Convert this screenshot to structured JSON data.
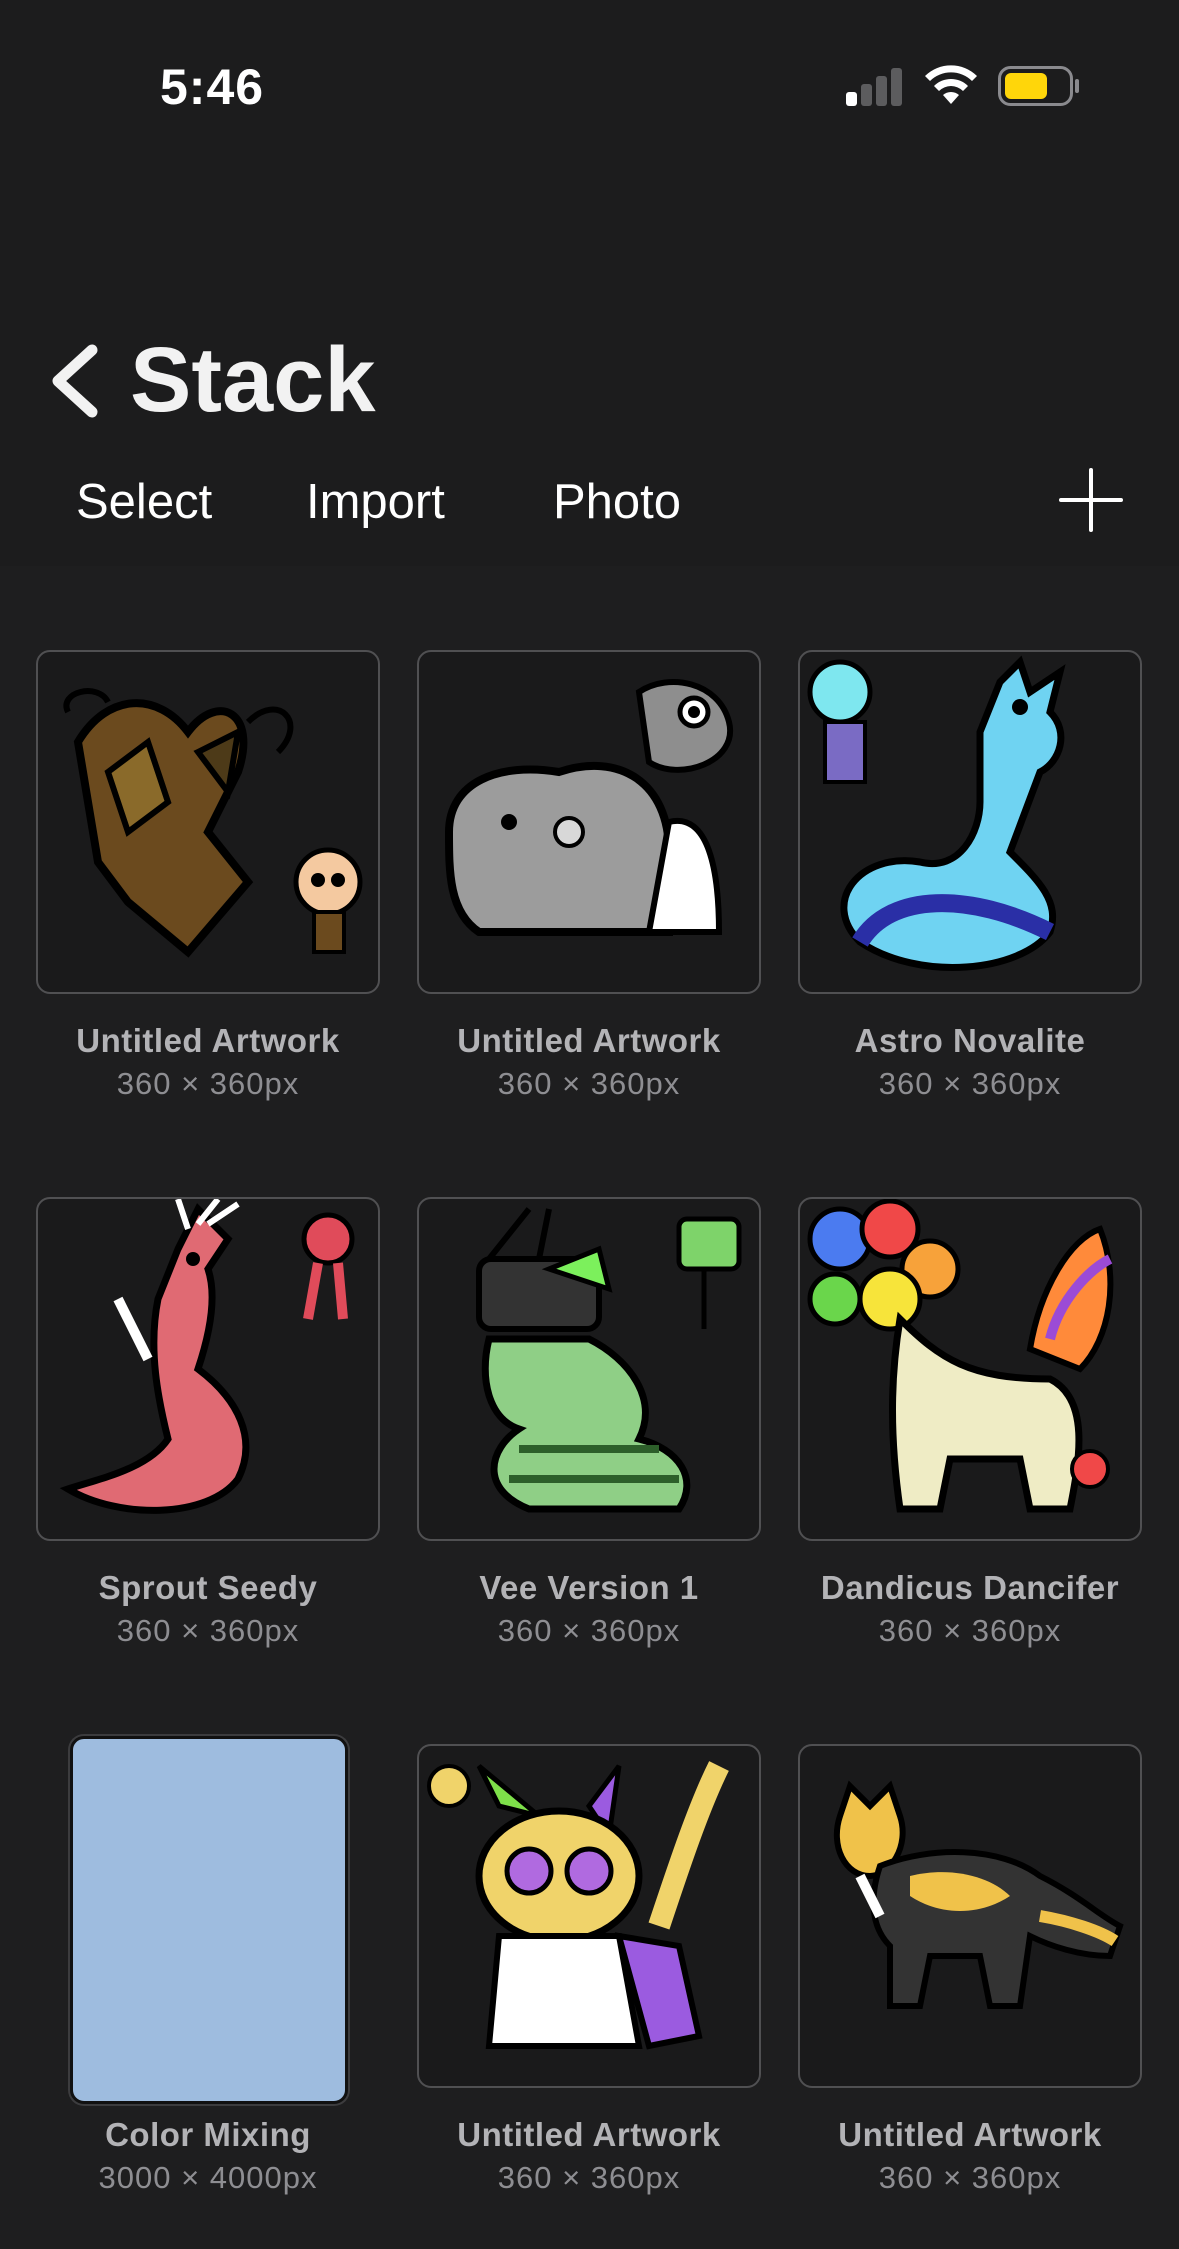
{
  "status_bar": {
    "time": "5:46"
  },
  "header": {
    "title": "Stack"
  },
  "toolbar": {
    "select": "Select",
    "import": "Import",
    "photo": "Photo"
  },
  "colors": {
    "accent_battery": "#ffd60a",
    "thumb_blue": "#9ebcdf"
  },
  "artworks": [
    {
      "name": "Untitled Artwork",
      "size": "360 × 360px"
    },
    {
      "name": "Untitled Artwork",
      "size": "360 × 360px"
    },
    {
      "name": "Astro Novalite",
      "size": "360 × 360px"
    },
    {
      "name": "Sprout Seedy",
      "size": "360 × 360px"
    },
    {
      "name": "Vee Version 1",
      "size": "360 × 360px"
    },
    {
      "name": "Dandicus Dancifer",
      "size": "360 × 360px"
    },
    {
      "name": "Color Mixing",
      "size": "3000 × 4000px"
    },
    {
      "name": "Untitled Artwork",
      "size": "360 × 360px"
    },
    {
      "name": "Untitled Artwork",
      "size": "360 × 360px"
    }
  ]
}
